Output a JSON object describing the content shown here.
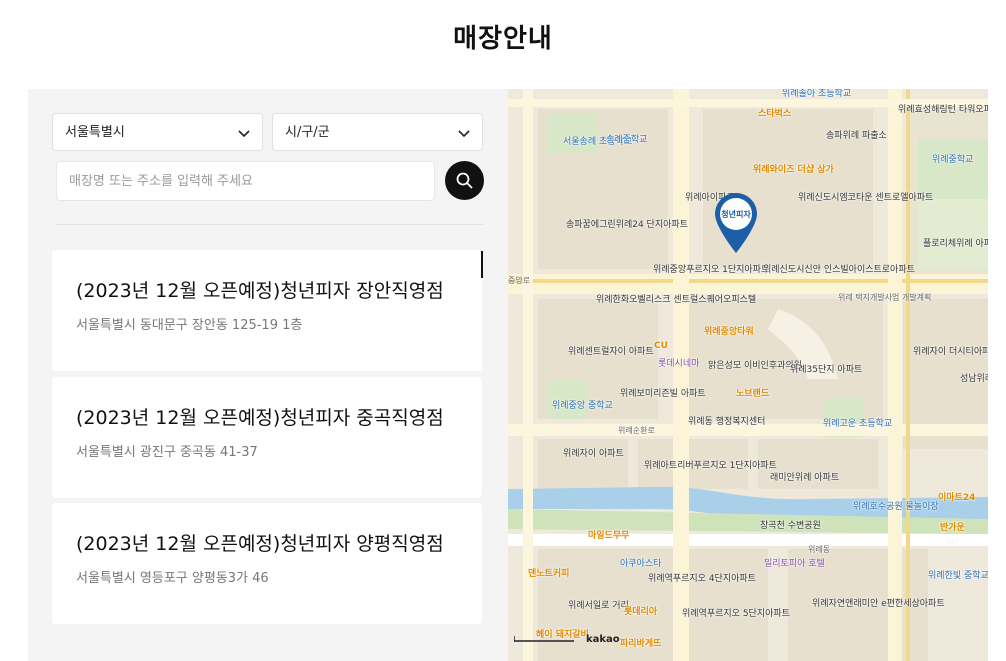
{
  "page": {
    "title": "매장안내"
  },
  "filters": {
    "city": "서울특별시",
    "district": "시/구/군",
    "search_placeholder": "매장명 또는 주소를 입력해 주세요"
  },
  "stores": [
    {
      "name": "(2023년 12월 오픈예정)청년피자 장안직영점",
      "address": "서울특별시 동대문구 장안동 125-19 1층"
    },
    {
      "name": "(2023년 12월 오픈예정)청년피자 중곡직영점",
      "address": "서울특별시 광진구 중곡동 41-37"
    },
    {
      "name": "(2023년 12월 오픈예정)청년피자 양평직영점",
      "address": "서울특별시 영등포구 양평동3가 46"
    }
  ],
  "map": {
    "pin_label": "청년피자",
    "attribution": "kakao",
    "labels": [
      "서울송례 초등학교",
      "스타벅스",
      "위례솔아 초등학교",
      "위례효성해링턴 타워오피스텔",
      "서울송례 초등학교",
      "송례중학교",
      "송파위례 파출소",
      "위례와이즈 더샵 상가",
      "위례아이파크",
      "위례신도시엠코타운 센트로엘아파트",
      "송파꿈에그린위례24 단지아파트",
      "위례중앙푸르지오 2단지아파트",
      "위례중학교",
      "위례순라초",
      "플로리체위례 아파트",
      "위례중앙푸르지오 1단지아파트",
      "위례신도시신안 인스빌아이스트로아파트",
      "중앙로",
      "위례 택지개발사업 개발계획",
      "위례한화오벨리스크 센트럴스퀘어오피스텔",
      "위례중앙타워",
      "CU",
      "위례센트럴자이 아파트",
      "롯데시네마",
      "맑은성모 이비인후과의원",
      "위례35단지 아파트",
      "위례자이 더시티아파트",
      "위례중앙 중학교",
      "위례보미리즌빌 아파트",
      "노브랜드",
      "위례동 행정복지센터",
      "위례고운 초등학교",
      "위례순환로",
      "위례자이 아파트",
      "위례아트리버푸르지오 1단지아파트",
      "래미안위례 아파트",
      "성남위례 파출소",
      "위례호수공원 물놀이장",
      "이마트24",
      "반가운",
      "마일드무무",
      "창곡천 수변공원",
      "위례동",
      "아쿠아스타",
      "밀리토피아 호텔",
      "덴노트커피",
      "위례역푸르지오 4단지아파트",
      "위례한빛 중학교",
      "위례서일로 거리",
      "롯데리아",
      "위례역푸르지오 5단지아파트",
      "위례자연앤래미안 e편한세상아파트",
      "헤이 돼지갈비",
      "파리바게뜨",
      "위례고등학교",
      "위례순환로",
      "바 피부"
    ]
  },
  "colors": {
    "accent": "#1d5ea8",
    "button": "#111111",
    "panel": "#f4f4f4"
  }
}
